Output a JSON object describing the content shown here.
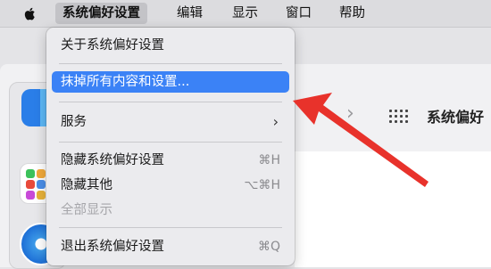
{
  "menubar": {
    "items": [
      "系统偏好设置",
      "编辑",
      "显示",
      "窗口",
      "帮助"
    ]
  },
  "dropdown": {
    "about": "关于系统偏好设置",
    "erase": "抹掉所有内容和设置...",
    "services": "服务",
    "hide": "隐藏系统偏好设置",
    "hide_shortcut": "⌘H",
    "hide_others": "隐藏其他",
    "hide_others_shortcut": "⌥⌘H",
    "show_all": "全部显示",
    "quit": "退出系统偏好设置",
    "quit_shortcut": "⌘Q"
  },
  "window": {
    "title": "系统偏好"
  },
  "colors": {
    "highlight": "#3b82f6",
    "arrow": "#e8322b"
  }
}
